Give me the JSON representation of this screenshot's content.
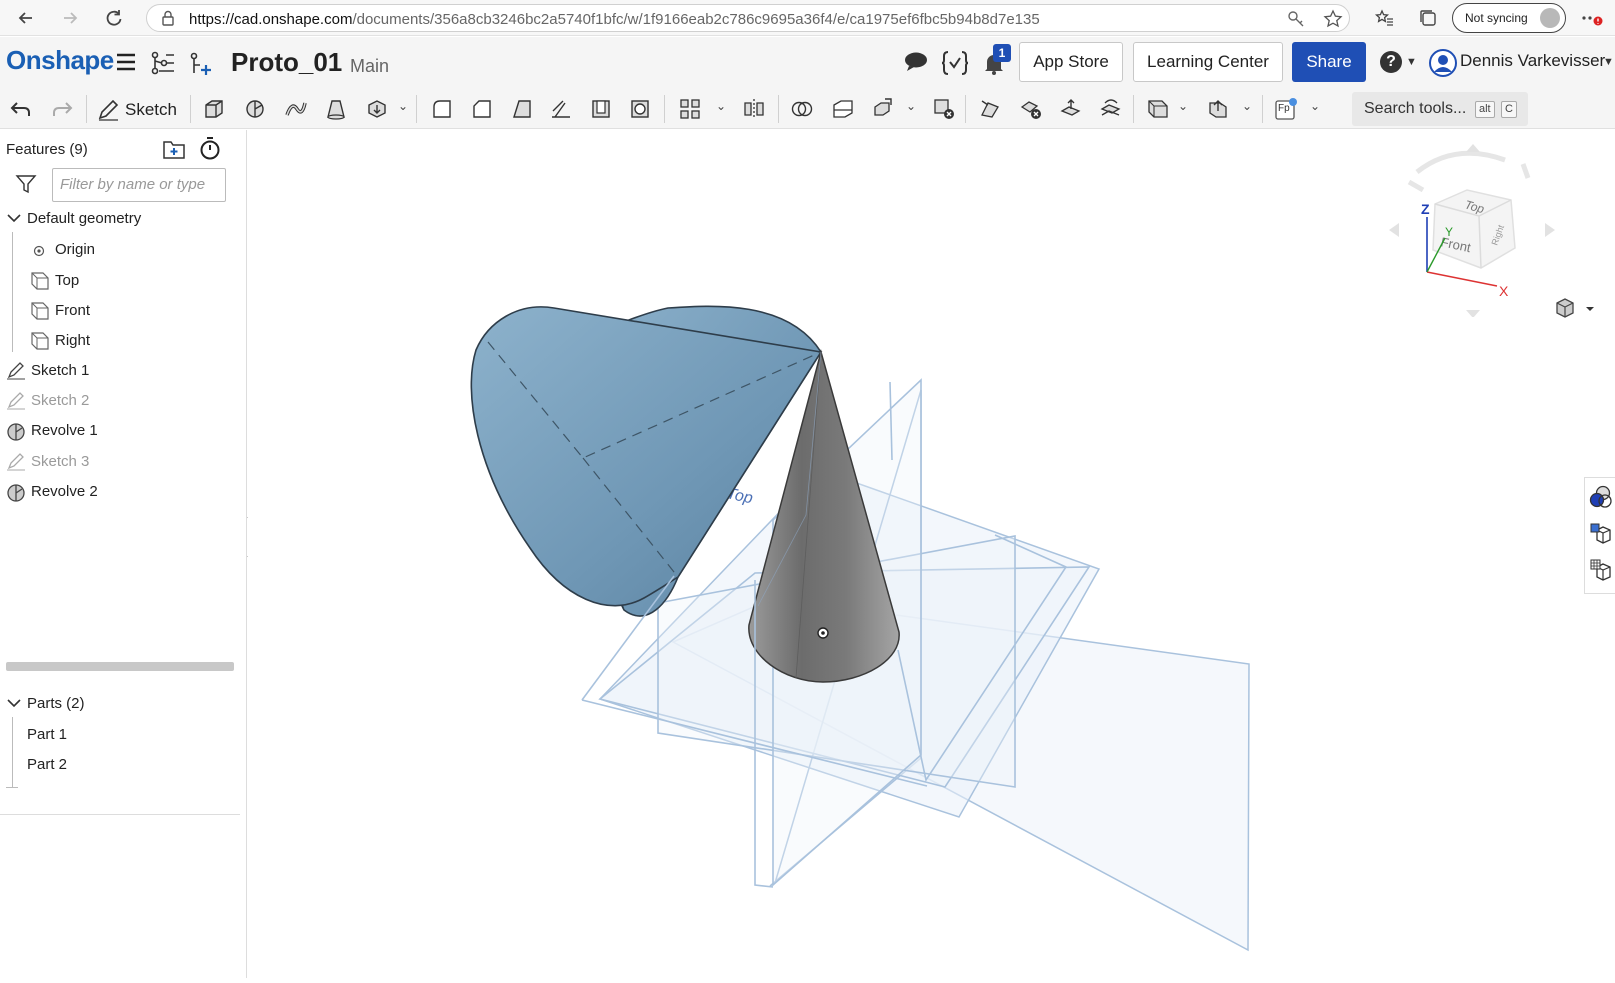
{
  "browser": {
    "url_host": "https://cad.onshape.com",
    "url_path": "/documents/356a8cb3246bc2a5740f1bfc/w/1f9166eab2c786c9695a36f4/e/ca1975ef6fbc5b94b8d7e135",
    "sync_label": "Not syncing"
  },
  "app": {
    "logo": "Onshape",
    "doc_title": "Proto_01",
    "workspace": "Main",
    "notification_count": "1",
    "app_store": "App Store",
    "learning_center": "Learning Center",
    "share": "Share",
    "help": "?",
    "user": "Dennis Varkevisser"
  },
  "toolbar": {
    "sketch_label": "Sketch",
    "search_label": "Search tools...",
    "shortcut_keys": [
      "alt",
      "C"
    ],
    "fp_label": "Fp"
  },
  "features": {
    "title": "Features (9)",
    "filter_placeholder": "Filter by name or type",
    "default_geometry": "Default geometry",
    "geometry_items": [
      "Origin",
      "Top",
      "Front",
      "Right"
    ],
    "items": [
      {
        "label": "Sketch 1",
        "type": "sketch",
        "suppressed": false
      },
      {
        "label": "Sketch 2",
        "type": "sketch",
        "suppressed": true
      },
      {
        "label": "Revolve 1",
        "type": "revolve",
        "suppressed": false
      },
      {
        "label": "Sketch 3",
        "type": "sketch",
        "suppressed": true
      },
      {
        "label": "Revolve 2",
        "type": "revolve",
        "suppressed": false
      }
    ]
  },
  "parts": {
    "title": "Parts (2)",
    "items": [
      "Part 1",
      "Part 2"
    ]
  },
  "viewcube": {
    "top": "Top",
    "front": "Front",
    "right": "Right",
    "axis_x": "X",
    "axis_y": "Y",
    "axis_z": "Z"
  },
  "viewport": {
    "plane_label": "Top"
  },
  "colors": {
    "brand": "#1a5fb4",
    "share": "#1f4fb5",
    "cone_blue": "#6f97b5",
    "cone_grey": "#7d7d7d",
    "plane": "#a9c2dd"
  }
}
